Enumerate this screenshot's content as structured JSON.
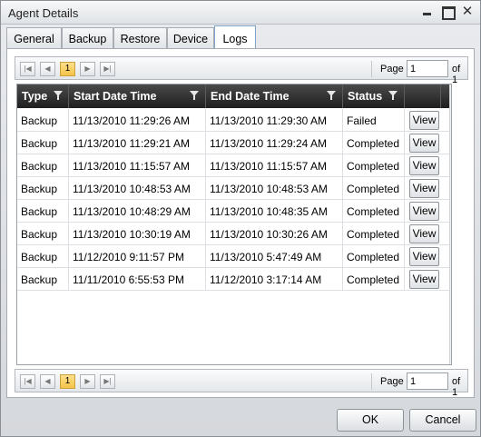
{
  "window": {
    "title": "Agent Details"
  },
  "tabs": [
    {
      "label": "General"
    },
    {
      "label": "Backup"
    },
    {
      "label": "Restore"
    },
    {
      "label": "Device"
    },
    {
      "label": "Logs"
    }
  ],
  "active_tab": "Logs",
  "pager": {
    "page_label": "Page",
    "page_value": "1",
    "of_label": "of 1",
    "current_page": "1"
  },
  "grid": {
    "columns": [
      "Type",
      "Start Date Time",
      "End Date Time",
      "Status",
      ""
    ],
    "rows": [
      {
        "type": "Backup",
        "start": "11/13/2010 11:29:26 AM",
        "end": "11/13/2010 11:29:30 AM",
        "status": "Failed",
        "action": "View"
      },
      {
        "type": "Backup",
        "start": "11/13/2010 11:29:21 AM",
        "end": "11/13/2010 11:29:24 AM",
        "status": "Completed",
        "action": "View"
      },
      {
        "type": "Backup",
        "start": "11/13/2010 11:15:57 AM",
        "end": "11/13/2010 11:15:57 AM",
        "status": "Completed",
        "action": "View"
      },
      {
        "type": "Backup",
        "start": "11/13/2010 10:48:53 AM",
        "end": "11/13/2010 10:48:53 AM",
        "status": "Completed",
        "action": "View"
      },
      {
        "type": "Backup",
        "start": "11/13/2010 10:48:29 AM",
        "end": "11/13/2010 10:48:35 AM",
        "status": "Completed",
        "action": "View"
      },
      {
        "type": "Backup",
        "start": "11/13/2010 10:30:19 AM",
        "end": "11/13/2010 10:30:26 AM",
        "status": "Completed",
        "action": "View"
      },
      {
        "type": "Backup",
        "start": "11/12/2010 9:11:57 PM",
        "end": "11/13/2010 5:47:49 AM",
        "status": "Completed",
        "action": "View"
      },
      {
        "type": "Backup",
        "start": "11/11/2010 6:55:53 PM",
        "end": "11/12/2010 3:17:14 AM",
        "status": "Completed",
        "action": "View"
      }
    ]
  },
  "buttons": {
    "ok": "OK",
    "cancel": "Cancel"
  },
  "colors": {
    "header_bg": "#2b2b2b",
    "page_highlight": "#f5c34a",
    "active_tab_border": "#7ea4c9"
  }
}
